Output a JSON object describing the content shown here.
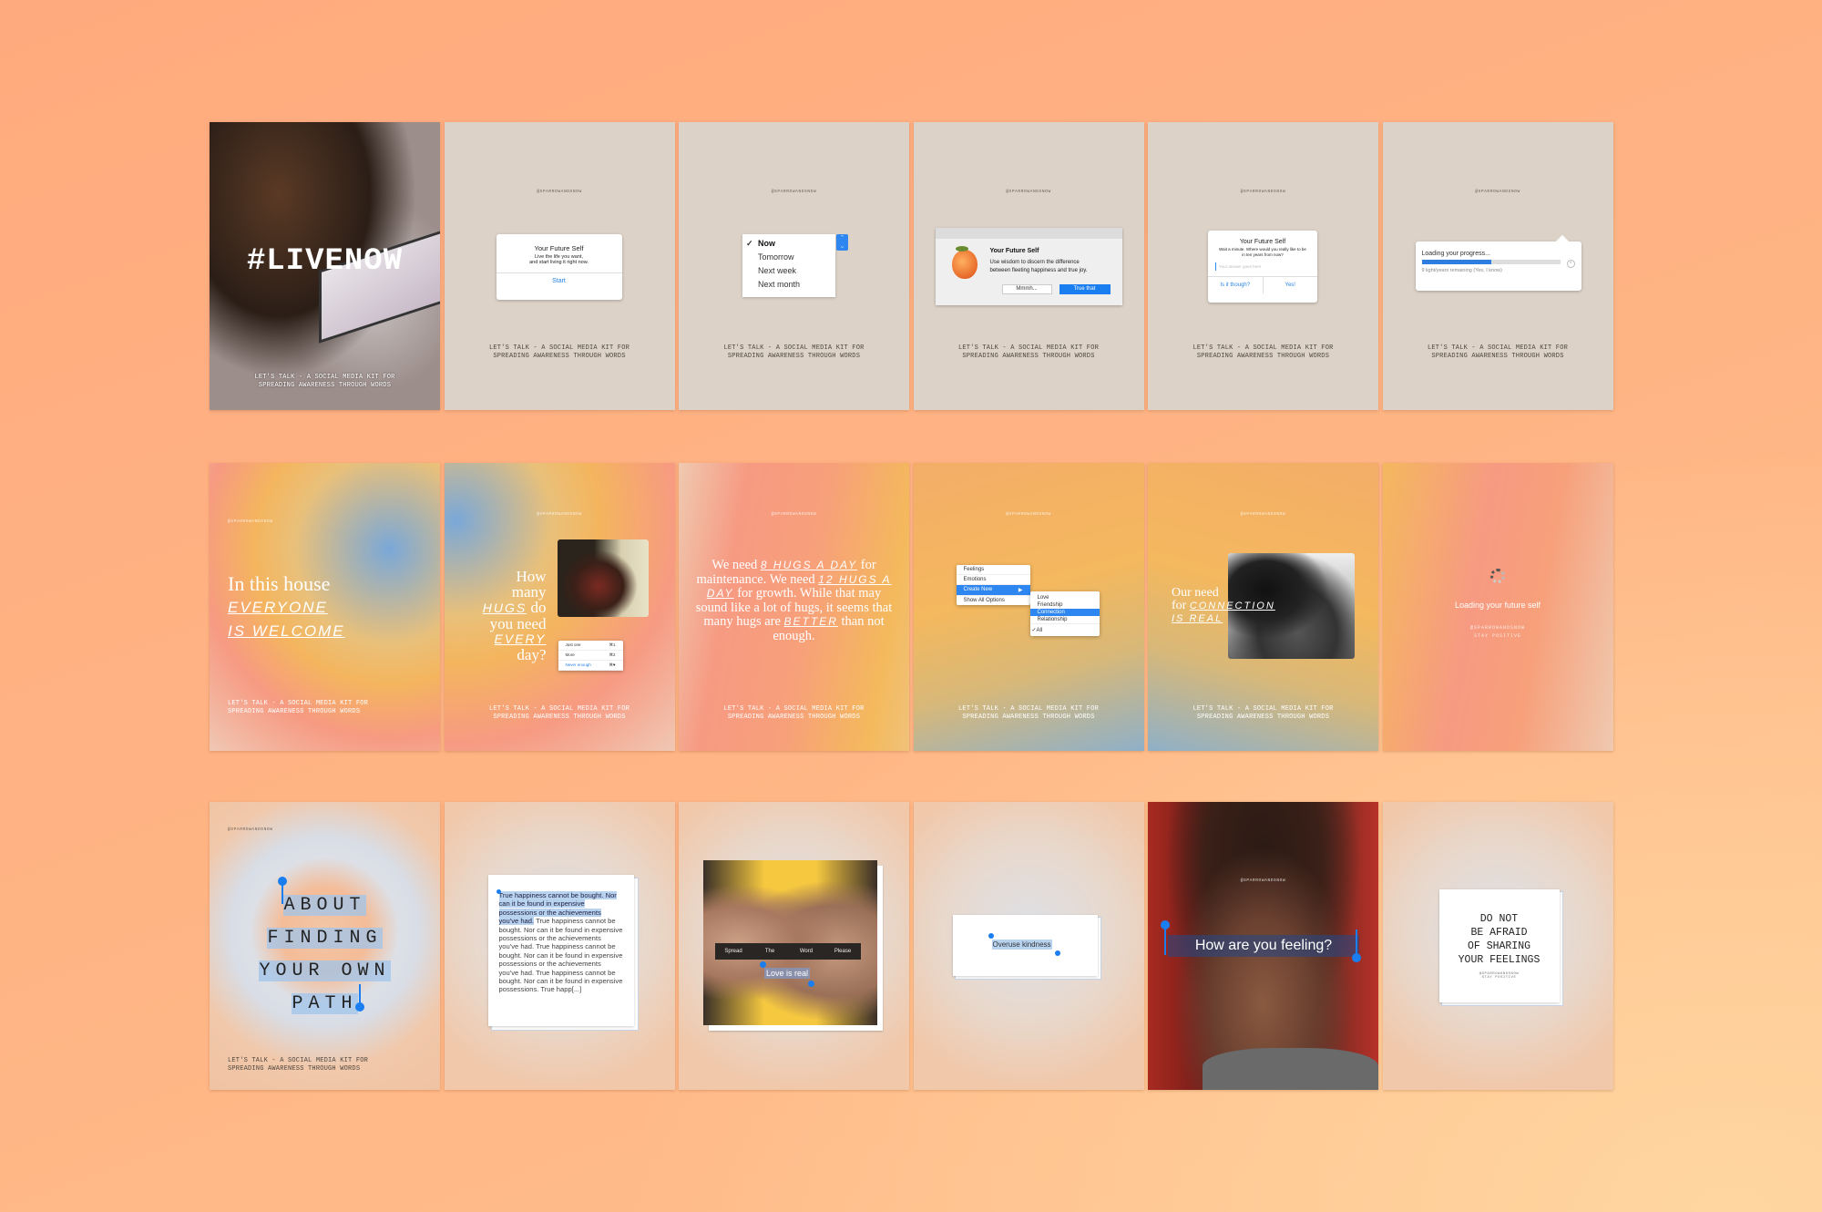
{
  "handle": "@SPARROWANDSNOW",
  "footer_line1": "LET'S TALK - A SOCIAL MEDIA KIT FOR",
  "footer_line2": "SPREADING AWARENESS THROUGH WORDS",
  "stay_positive": "STAY POSITIVE",
  "colors": {
    "accent_blue": "#2e86f0",
    "beige": "#dcd2c7",
    "background": "#ffb080"
  },
  "row1": {
    "livenow": {
      "title": "#LIVENOW"
    },
    "future_self": {
      "title": "Your Future Self",
      "body1": "Live the life you want,",
      "body2": "and start living it right now.",
      "button": "Start"
    },
    "dropdown": {
      "options": [
        "Now",
        "Tomorrow",
        "Next week",
        "Next month"
      ],
      "selected": "Now"
    },
    "alert": {
      "icon": "peach-icon",
      "title": "Your Future Self",
      "body1": "Use wisdom to discern the difference",
      "body2": "between fleeting happiness and true joy.",
      "cancel": "Mmmh...",
      "confirm": "True that"
    },
    "prompt": {
      "title": "Your Future Self",
      "body": "Wait a minute. Where would you really like to be in ten years from now?",
      "placeholder": "Your answer goes here",
      "left": "Is it though?",
      "right": "Yes!"
    },
    "progress": {
      "title": "Loading your progress...",
      "remaining": "9 light/years remaining (Yes, I know)",
      "percent": 50
    }
  },
  "row2": {
    "house": {
      "line1": "In this house",
      "line2": "EVERYONE",
      "line3": "IS WELCOME"
    },
    "hugs": {
      "l1": "How",
      "l2": "many",
      "l3a": "HUGS",
      "l3b": " do",
      "l4": "you need",
      "l5": "EVERY",
      "l6": "day?",
      "menu": [
        {
          "label": "Just one",
          "key": "⌘1"
        },
        {
          "label": "More",
          "key": "⌘2"
        },
        {
          "label": "Never enough",
          "key": "⌘♥"
        }
      ]
    },
    "quote": {
      "a": "We need ",
      "b": "8 HUGS A DAY",
      "c": " for maintenance. We need ",
      "d": "12 HUGS A DAY",
      "e": " for growth. While that may sound like a lot of hugs, it seems that many hugs are ",
      "f": "BETTER",
      "g": " than not enough."
    },
    "context_menu": {
      "items": [
        "Feelings",
        "Emotions",
        "Create New",
        "Show All Options"
      ],
      "submenu": [
        "Love",
        "Friendship",
        "Connection",
        "Relationship",
        "All"
      ],
      "selected": "Connection",
      "checked": "All"
    },
    "connection": {
      "l1": "Our need",
      "l2a": "for ",
      "l2b": "CONNECTION",
      "l3": "IS REAL"
    },
    "loading": {
      "text": "Loading your future self"
    }
  },
  "row3": {
    "path": {
      "lines": [
        "ABOUT",
        "FINDING",
        "YOUR OWN",
        "PATH"
      ]
    },
    "happiness": {
      "selected": "True happiness cannot be bought. Nor can it be found in expensive possessions or the achievements you've had.",
      "rest": " True happiness cannot be bought. Nor can it be found in expensive possessions or the achievements you've had. True happiness cannot be bought. Nor can it be found in expensive possessions or the achievements you've had. True happiness cannot be bought. Nor can it be found in expensive possessions. True happ[...]"
    },
    "love": {
      "toolbar": [
        "Spread",
        "The",
        "Word",
        "Please"
      ],
      "selected": "Love is real"
    },
    "kindness": {
      "selected": "Overuse kindness"
    },
    "feeling": {
      "selected": "How are you feeling?"
    },
    "afraid": {
      "lines": [
        "DO NOT",
        "BE AFRAID",
        "OF SHARING",
        "YOUR FEELINGS"
      ]
    }
  }
}
